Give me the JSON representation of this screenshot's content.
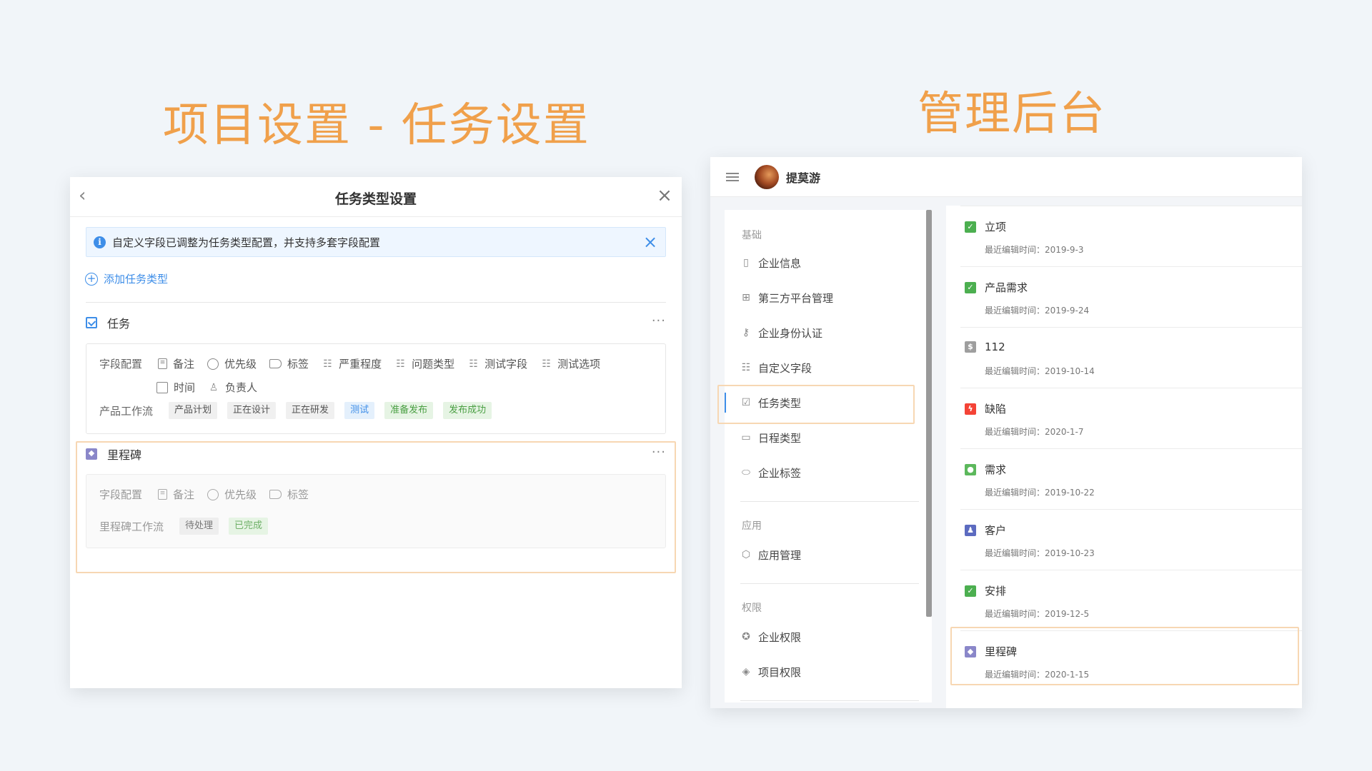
{
  "headlines": {
    "left": "项目设置 - 任务设置",
    "right": "管理后台"
  },
  "left_panel": {
    "title": "任务类型设置",
    "alert": "自定义字段已调整为任务类型配置，并支持多套字段配置",
    "add_type": "添加任务类型",
    "task_type": {
      "name": "任务",
      "field_config_label": "字段配置",
      "fields": [
        "备注",
        "优先级",
        "标签",
        "严重程度",
        "问题类型",
        "测试字段",
        "测试选项"
      ],
      "fields_row2": [
        "时间",
        "负责人"
      ],
      "workflow_label": "产品工作流",
      "workflow": [
        "产品计划",
        "正在设计",
        "正在研发",
        "测试",
        "准备发布",
        "发布成功"
      ]
    },
    "milestone_type": {
      "name": "里程碑",
      "field_config_label": "字段配置",
      "fields": [
        "备注",
        "优先级",
        "标签"
      ],
      "workflow_label": "里程碑工作流",
      "workflow": [
        "待处理",
        "已完成"
      ]
    }
  },
  "right_panel": {
    "user_name": "提莫游",
    "sidebar": {
      "sections": [
        "基础",
        "应用",
        "权限"
      ],
      "basic_items": [
        "企业信息",
        "第三方平台管理",
        "企业身份认证",
        "自定义字段",
        "任务类型",
        "日程类型",
        "企业标签"
      ],
      "app_items": [
        "应用管理"
      ],
      "perm_items": [
        "企业权限",
        "项目权限"
      ],
      "active": "任务类型"
    },
    "list": [
      {
        "name": "立项",
        "meta": "最近编辑时间：2019-9-3",
        "color": "#4caf50"
      },
      {
        "name": "产品需求",
        "meta": "最近编辑时间：2019-9-24",
        "color": "#4caf50"
      },
      {
        "name": "112",
        "meta": "最近编辑时间：2019-10-14",
        "color": "#9e9e9e"
      },
      {
        "name": "缺陷",
        "meta": "最近编辑时间：2020-1-7",
        "color": "#f44336"
      },
      {
        "name": "需求",
        "meta": "最近编辑时间：2019-10-22",
        "color": "#5cb85c"
      },
      {
        "name": "客户",
        "meta": "最近编辑时间：2019-10-23",
        "color": "#5c6bc0"
      },
      {
        "name": "安排",
        "meta": "最近编辑时间：2019-12-5",
        "color": "#4caf50"
      },
      {
        "name": "里程碑",
        "meta": "最近编辑时间：2020-1-15",
        "color": "#8a87c9"
      }
    ]
  }
}
